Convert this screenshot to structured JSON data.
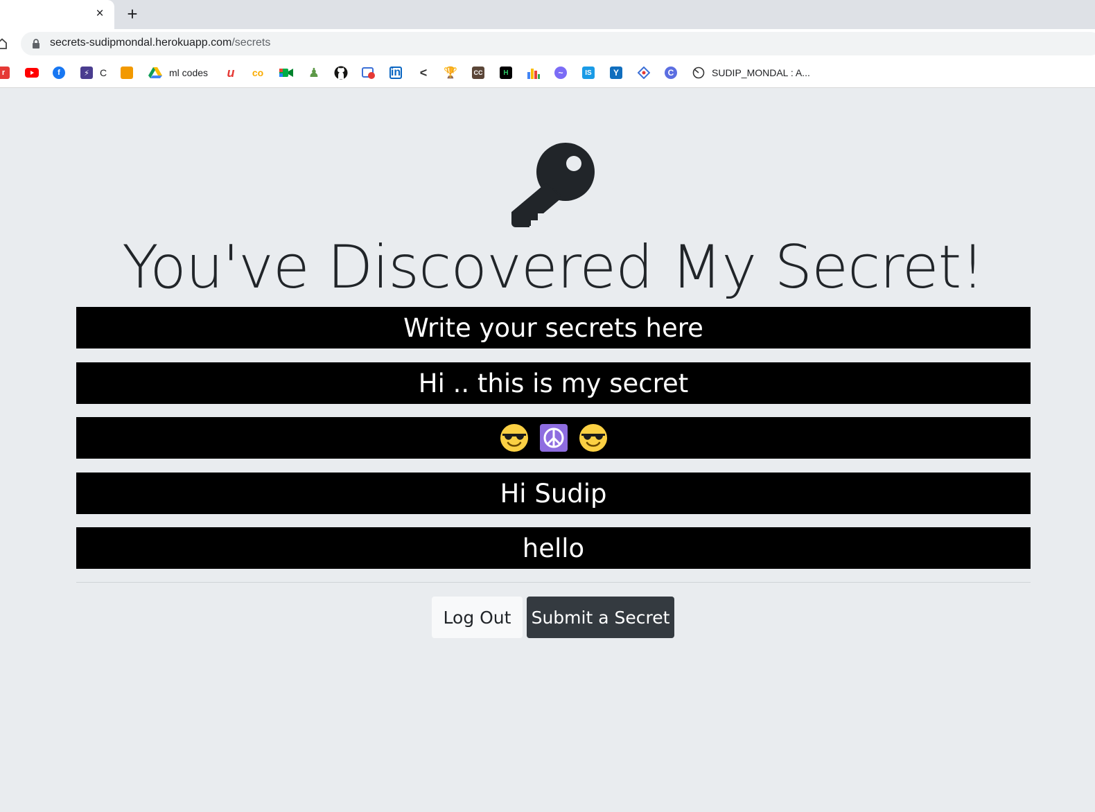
{
  "browser": {
    "tab_close": "×",
    "new_tab": "+",
    "url_host": "secrets-sudipmondal.herokuapp.com",
    "url_path": "/secrets",
    "bookmarks": [
      {
        "icon": "red-r-icon",
        "label": ""
      },
      {
        "icon": "youtube-icon",
        "label": ""
      },
      {
        "icon": "facebook-icon",
        "label": ""
      },
      {
        "icon": "lightning-icon",
        "label": "C"
      },
      {
        "icon": "notebook-icon",
        "label": ""
      },
      {
        "icon": "google-drive-icon",
        "label": "ml codes"
      },
      {
        "icon": "udemy-icon",
        "label": ""
      },
      {
        "icon": "colab-icon",
        "label": ""
      },
      {
        "icon": "google-meet-icon",
        "label": ""
      },
      {
        "icon": "chess-icon",
        "label": ""
      },
      {
        "icon": "github-icon",
        "label": ""
      },
      {
        "icon": "record-icon",
        "label": ""
      },
      {
        "icon": "linkedin-icon",
        "label": ""
      },
      {
        "icon": "code-icon",
        "label": ""
      },
      {
        "icon": "trophy-icon",
        "label": ""
      },
      {
        "icon": "codechef-icon",
        "label": ""
      },
      {
        "icon": "hackerrank-icon",
        "label": ""
      },
      {
        "icon": "bar-chart-icon",
        "label": ""
      },
      {
        "icon": "wave-icon",
        "label": ""
      },
      {
        "icon": "is-icon",
        "label": ""
      },
      {
        "icon": "yammer-icon",
        "label": ""
      },
      {
        "icon": "diamond-icon",
        "label": ""
      },
      {
        "icon": "c-circle-icon",
        "label": ""
      },
      {
        "icon": "clock-icon",
        "label": "SUDIP_MONDAL : A..."
      }
    ]
  },
  "page": {
    "title": "You've Discovered My Secret!",
    "secrets": [
      "Write your secrets here",
      "Hi .. this is my secret",
      "",
      "Hi Sudip",
      "hello"
    ],
    "emoji_secret_icons": [
      "sunglasses-emoji-icon",
      "peace-symbol-icon",
      "sunglasses-emoji-icon"
    ],
    "logout_label": "Log Out",
    "submit_label": "Submit a Secret"
  }
}
